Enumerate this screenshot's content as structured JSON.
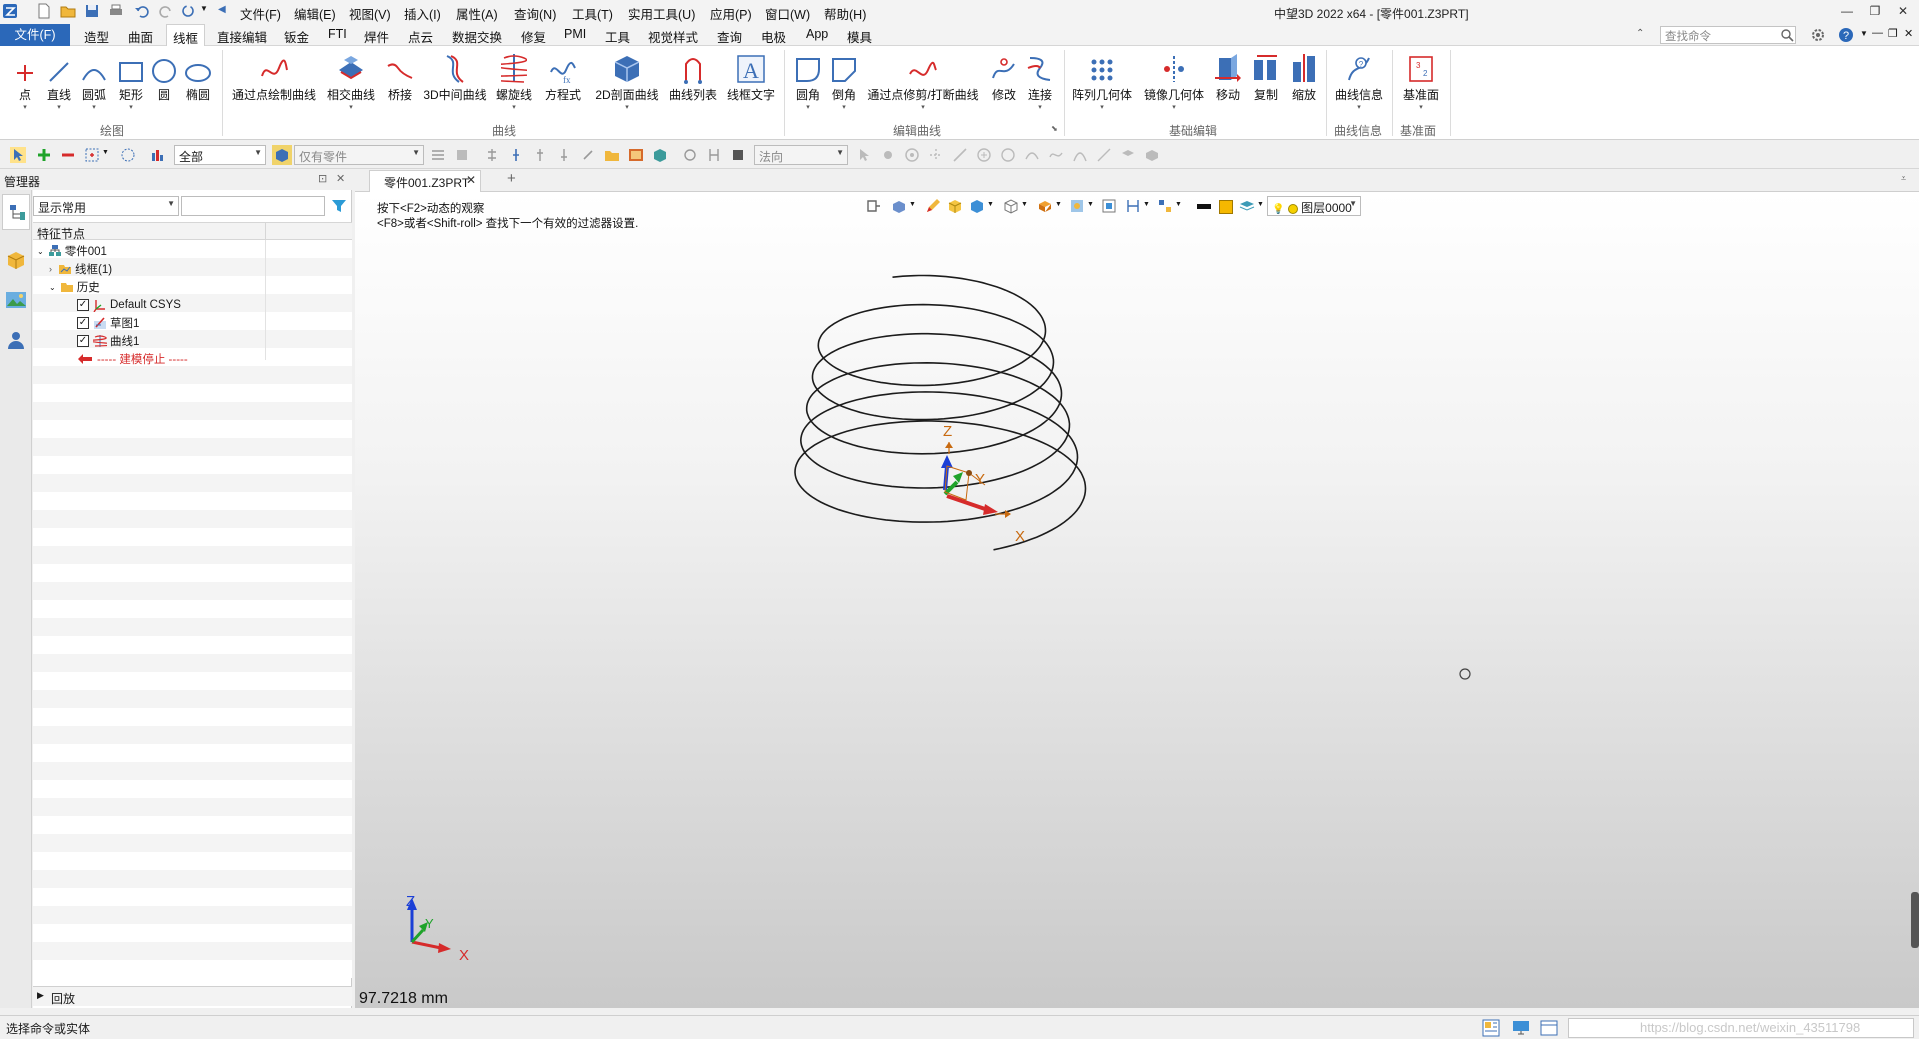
{
  "app": {
    "title": "中望3D 2022 x64 - [零件001.Z3PRT]"
  },
  "menubar": [
    "文件(F)",
    "编辑(E)",
    "视图(V)",
    "插入(I)",
    "属性(A)",
    "查询(N)",
    "工具(T)",
    "实用工具(U)",
    "应用(P)",
    "窗口(W)",
    "帮助(H)"
  ],
  "ribbon_tabs": {
    "file": "文件(F)",
    "items": [
      "造型",
      "曲面",
      "线框",
      "直接编辑",
      "钣金",
      "FTI",
      "焊件",
      "点云",
      "数据交换",
      "修复",
      "PMI",
      "工具",
      "视觉样式",
      "查询",
      "电极",
      "App",
      "模具"
    ],
    "active": "线框"
  },
  "search": {
    "placeholder": "查找命令"
  },
  "ribbon": {
    "draw": {
      "label": "绘图",
      "buttons": [
        "点",
        "直线",
        "圆弧",
        "矩形",
        "圆",
        "椭圆"
      ]
    },
    "curve": {
      "label": "曲线",
      "buttons": [
        "通过点绘制曲线",
        "相交曲线",
        "桥接",
        "3D中间曲线",
        "螺旋线",
        "方程式",
        "2D剖面曲线",
        "曲线列表",
        "线框文字"
      ]
    },
    "edit_curve": {
      "label": "编辑曲线",
      "buttons": [
        "圆角",
        "倒角",
        "通过点修剪/打断曲线",
        "修改",
        "连接"
      ]
    },
    "basic_edit": {
      "label": "基础编辑",
      "buttons": [
        "阵列几何体",
        "镜像几何体",
        "移动",
        "复制",
        "缩放"
      ]
    },
    "curve_info": {
      "label": "曲线信息",
      "buttons": [
        "曲线信息"
      ]
    },
    "datum": {
      "label": "基准面",
      "buttons": [
        "基准面"
      ]
    }
  },
  "toolbar": {
    "filter": "全部",
    "scope": "仅有零件",
    "direction": "法向"
  },
  "manager": {
    "title": "管理器",
    "display_filter": "显示常用",
    "column_header": "特征节点",
    "tree": {
      "root": "零件001",
      "wireframe": "线框(1)",
      "history": "历史",
      "items": [
        "Default CSYS",
        "草图1",
        "曲线1"
      ],
      "stop": "----- 建模停止 -----"
    },
    "rollback": "回放"
  },
  "document": {
    "tab": "零件001.Z3PRT",
    "hint1": "按下<F2>动态的观察",
    "hint2": "<F8>或者<Shift-roll> 查找下一个有效的过滤器设置.",
    "layer": "图层0000",
    "measure": "97.7218 mm"
  },
  "axes": {
    "x": "X",
    "y": "Y",
    "z": "Z"
  },
  "status": {
    "prompt": "选择命令或实体",
    "watermark": "https://blog.csdn.net/weixin_43511798"
  },
  "colors": {
    "accent": "#2b68b9",
    "axis_x": "#d62b2b",
    "axis_y": "#1fa32a",
    "axis_z": "#1b3fd6",
    "label_orange": "#c86a10"
  }
}
